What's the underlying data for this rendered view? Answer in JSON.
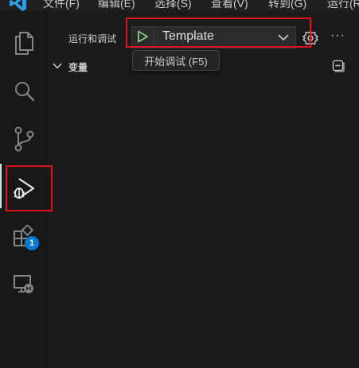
{
  "menubar": {
    "logo_icon": "vscode-logo-icon",
    "items": [
      {
        "label": "文件(F)"
      },
      {
        "label": "编辑(E)"
      },
      {
        "label": "选择(S)"
      },
      {
        "label": "查看(V)"
      },
      {
        "label": "转到(G)"
      },
      {
        "label": "运行(R"
      }
    ]
  },
  "activity_bar": {
    "items": [
      {
        "name": "explorer",
        "icon": "files-icon"
      },
      {
        "name": "search",
        "icon": "search-icon"
      },
      {
        "name": "source-control",
        "icon": "source-control-icon"
      },
      {
        "name": "run-and-debug",
        "icon": "run-debug-icon",
        "active": true
      },
      {
        "name": "extensions",
        "icon": "extensions-icon",
        "badge": "1"
      },
      {
        "name": "remote-explorer",
        "icon": "remote-explorer-icon"
      }
    ]
  },
  "sidebar": {
    "title": "运行和调试",
    "config": {
      "selected": "Template",
      "play_icon": "play-icon",
      "dropdown_icon": "chevron-down-icon"
    },
    "gear_icon": "gear-icon",
    "more_icon": "ellipsis-icon",
    "more_label": "···",
    "tooltip": "开始调试 (F5)",
    "variables_section": {
      "title": "变量",
      "collapse_icon": "collapse-all-icon"
    }
  },
  "colors": {
    "accent_blue": "#0078d4",
    "play_green": "#89d185",
    "highlight_red": "#e0141e"
  }
}
